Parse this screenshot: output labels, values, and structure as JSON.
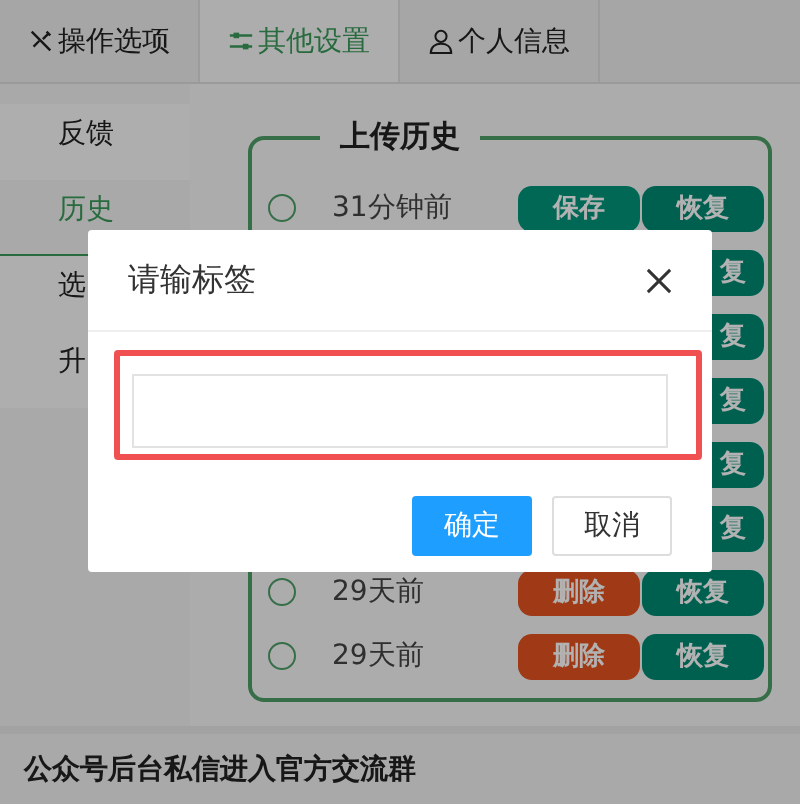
{
  "tabs": [
    {
      "label": "操作选项",
      "selected": false
    },
    {
      "label": "其他设置",
      "selected": true
    },
    {
      "label": "个人信息",
      "selected": false
    }
  ],
  "sidebar": [
    {
      "label": "反馈",
      "selected": false
    },
    {
      "label": "历史",
      "selected": true
    },
    {
      "label": "选",
      "selected": false
    },
    {
      "label": "升",
      "selected": false
    }
  ],
  "history": {
    "title": "上传历史",
    "rows": [
      {
        "time": "31分钟前",
        "selected": false,
        "buttons": [
          {
            "label": "保存",
            "kind": "save"
          },
          {
            "label": "恢复",
            "kind": "restore"
          }
        ]
      },
      {
        "buttons": [
          {
            "label": "复",
            "kind": "restore"
          }
        ]
      },
      {
        "buttons": [
          {
            "label": "复",
            "kind": "restore"
          }
        ]
      },
      {
        "buttons": [
          {
            "label": "复",
            "kind": "restore"
          }
        ]
      },
      {
        "buttons": [
          {
            "label": "复",
            "kind": "restore"
          }
        ]
      },
      {
        "buttons": [
          {
            "label": "复",
            "kind": "restore"
          }
        ]
      },
      {
        "time": "29天前",
        "selected": false,
        "buttons": [
          {
            "label": "删除",
            "kind": "delete"
          },
          {
            "label": "恢复",
            "kind": "restore"
          }
        ]
      },
      {
        "time": "29天前",
        "selected": false,
        "buttons": [
          {
            "label": "删除",
            "kind": "delete"
          },
          {
            "label": "恢复",
            "kind": "restore"
          }
        ]
      }
    ]
  },
  "footer": "公众号后台私信进入官方交流群",
  "dialog": {
    "title": "请输标签",
    "input": {
      "highlighted": true
    },
    "buttons": [
      {
        "label": "确定",
        "kind": "primary"
      },
      {
        "label": "取消",
        "kind": "default"
      }
    ]
  }
}
